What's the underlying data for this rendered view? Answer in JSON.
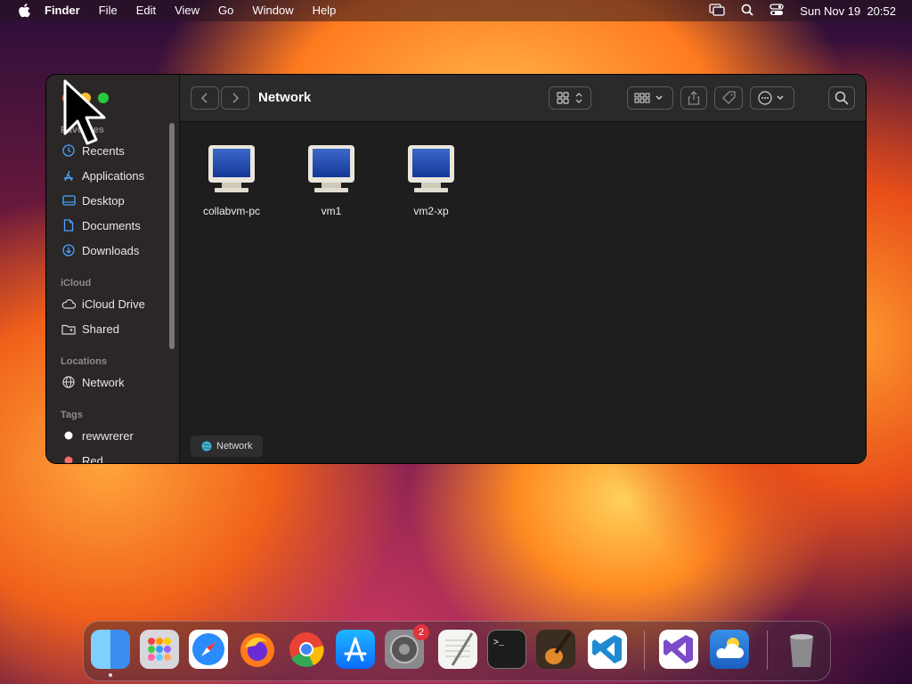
{
  "menubar": {
    "app_name": "Finder",
    "menus": [
      "File",
      "Edit",
      "View",
      "Go",
      "Window",
      "Help"
    ],
    "datetime": "Sun Nov 19  20:52"
  },
  "window": {
    "title": "Network",
    "sidebar": {
      "favorites_header": "Favorites",
      "favorites": [
        {
          "label": "Recents",
          "icon": "clock-icon"
        },
        {
          "label": "Applications",
          "icon": "applications-icon"
        },
        {
          "label": "Desktop",
          "icon": "desktop-icon"
        },
        {
          "label": "Documents",
          "icon": "document-icon"
        },
        {
          "label": "Downloads",
          "icon": "download-icon"
        }
      ],
      "icloud_header": "iCloud",
      "icloud": [
        {
          "label": "iCloud Drive",
          "icon": "cloud-icon"
        },
        {
          "label": "Shared",
          "icon": "shared-folder-icon"
        }
      ],
      "locations_header": "Locations",
      "locations": [
        {
          "label": "Network",
          "icon": "globe-icon"
        }
      ],
      "tags_header": "Tags",
      "tags": [
        {
          "label": "rewwrerer",
          "color": "#ffffff"
        },
        {
          "label": "Red",
          "color": "#ff6b6b"
        }
      ]
    },
    "files": [
      {
        "label": "collabvm-pc",
        "icon": "computer-icon"
      },
      {
        "label": "vm1",
        "icon": "computer-icon"
      },
      {
        "label": "vm2-xp",
        "icon": "computer-icon"
      }
    ],
    "pathbar": {
      "label": "Network"
    }
  },
  "dock": {
    "apps": [
      "Finder",
      "Launchpad",
      "Safari",
      "Firefox",
      "Chrome",
      "App Store",
      "System Settings",
      "TextEdit",
      "Terminal",
      "GarageBand",
      "Visual Studio Code",
      "Visual Studio",
      "Weather",
      "Trash"
    ],
    "settings_badge": "2"
  }
}
